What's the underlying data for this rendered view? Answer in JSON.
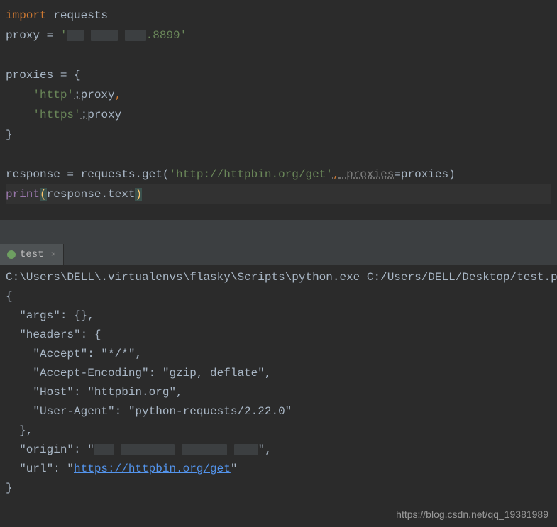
{
  "editor": {
    "lines": {
      "l1_kw": "import",
      "l1_mod": " requests",
      "l2_var": "proxy = ",
      "l2_str_open": "'",
      "l2_str_end": ".8899'",
      "l3_var": "proxies = {",
      "l4_key": "    'http'",
      "l4_colon": ":",
      "l4_val": "proxy",
      "l4_comma": ",",
      "l5_key": "    'https'",
      "l5_colon": ":",
      "l5_val": "proxy",
      "l6": "}",
      "l7_pre": "response = requests.get(",
      "l7_url": "'http://httpbin.org/get'",
      "l7_comma": ",",
      "l7_param": " proxies",
      "l7_post": "=proxies)",
      "l8_print": "print",
      "l8_open": "(",
      "l8_body": "response.text",
      "l8_close": ")"
    }
  },
  "tab": {
    "name": "test",
    "close": "×"
  },
  "console": {
    "cmd": "C:\\Users\\DELL\\.virtualenvs\\flasky\\Scripts\\python.exe C:/Users/DELL/Desktop/test.py",
    "l2": "{",
    "l3": "  \"args\": {}, ",
    "l4": "  \"headers\": {",
    "l5": "    \"Accept\": \"*/*\", ",
    "l6": "    \"Accept-Encoding\": \"gzip, deflate\", ",
    "l7": "    \"Host\": \"httpbin.org\", ",
    "l8": "    \"User-Agent\": \"python-requests/2.22.0\"",
    "l9": "  }, ",
    "l10_pre": "  \"origin\": \"",
    "l10_post": "\", ",
    "l11_pre": "  \"url\": \"",
    "l11_url": "https://httpbin.org/get",
    "l11_post": "\"",
    "l12": "}"
  },
  "watermark": "https://blog.csdn.net/qq_19381989"
}
